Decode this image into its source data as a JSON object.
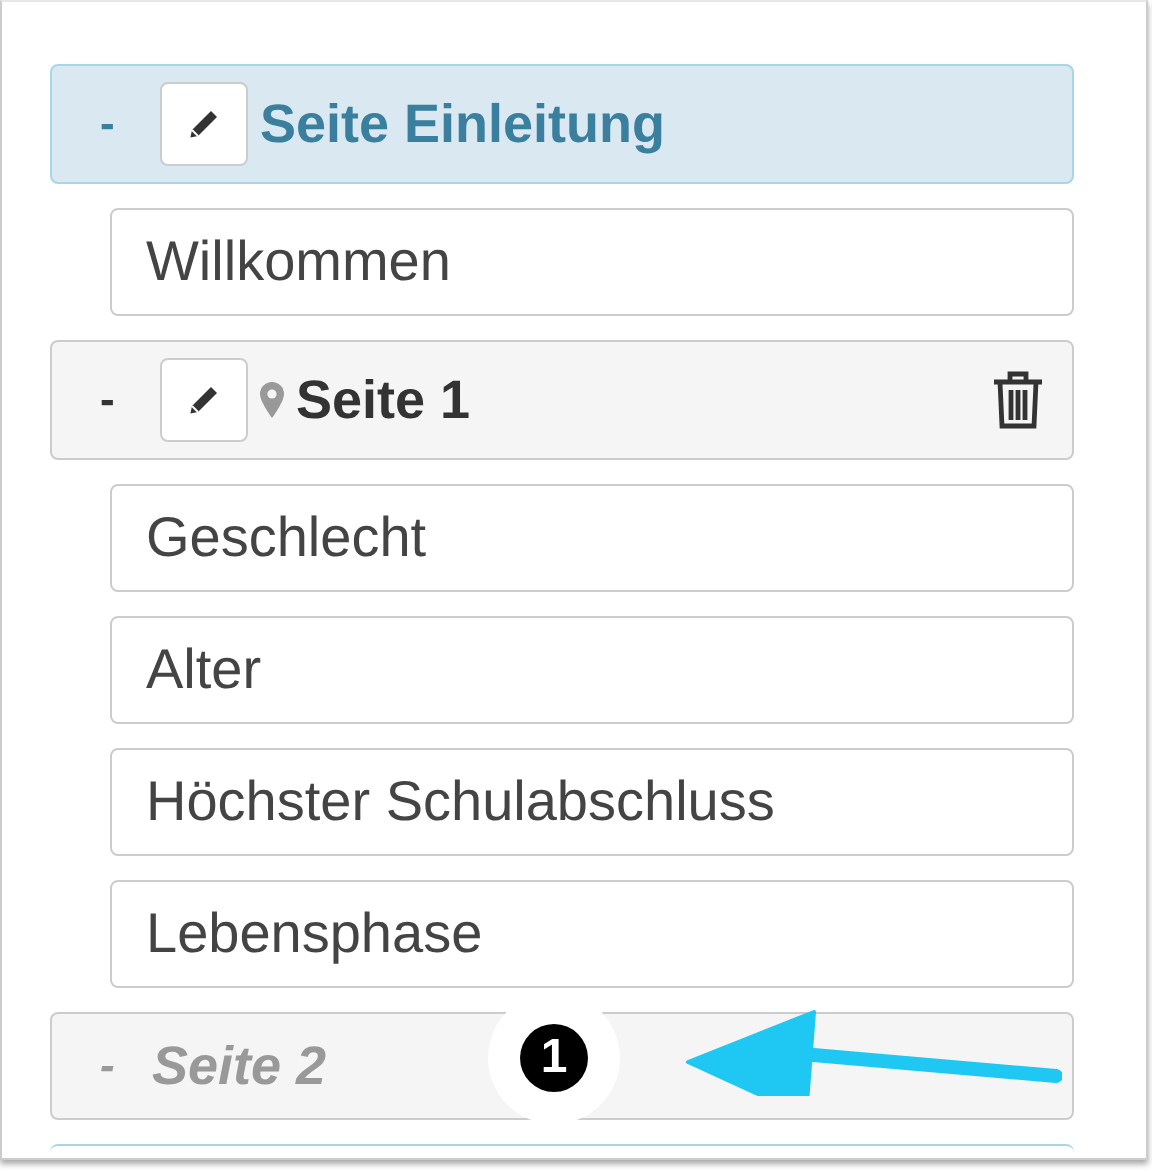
{
  "pages": [
    {
      "title": "Seite Einleitung",
      "toggle": "-",
      "selected": true,
      "disabled": false,
      "show_edit": true,
      "show_pin": false,
      "show_trash": false,
      "items": [
        "Willkommen"
      ]
    },
    {
      "title": "Seite 1",
      "toggle": "-",
      "selected": false,
      "disabled": false,
      "show_edit": true,
      "show_pin": true,
      "show_trash": true,
      "items": [
        "Geschlecht",
        "Alter",
        "Höchster Schulabschluss",
        "Lebensphase"
      ]
    },
    {
      "title": "Seite 2",
      "toggle": "-",
      "selected": false,
      "disabled": true,
      "show_edit": false,
      "show_pin": false,
      "show_trash": false
    }
  ],
  "callout": {
    "number": "1"
  }
}
